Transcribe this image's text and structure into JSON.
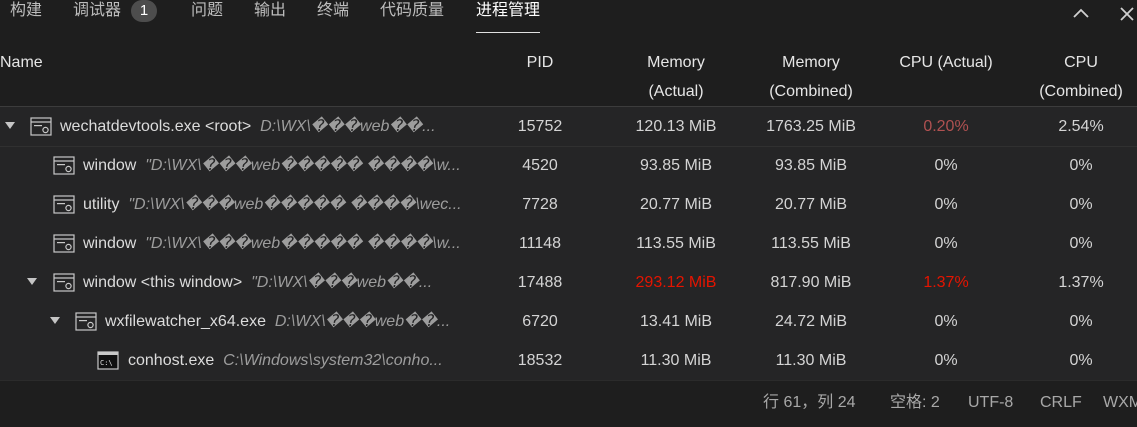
{
  "tabs": [
    {
      "label": "构建"
    },
    {
      "label": "调试器",
      "badge": "1"
    },
    {
      "label": "问题"
    },
    {
      "label": "输出"
    },
    {
      "label": "终端"
    },
    {
      "label": "代码质量"
    },
    {
      "label": "进程管理",
      "active": true
    }
  ],
  "panel_controls": {
    "collapse_icon": "chevron-up-icon",
    "close_icon": "close-icon"
  },
  "columns": {
    "name": "Name",
    "pid": "PID",
    "mem_actual": "Memory\n(Actual)",
    "mem_combined": "Memory\n(Combined)",
    "cpu_actual": "CPU (Actual)",
    "cpu_combined": "CPU\n(Combined)"
  },
  "processes": [
    {
      "name": "wechatdevtools.exe <root>",
      "path": "D:\\WX\\���web��...",
      "pid": "15752",
      "mem_actual": "120.13 MiB",
      "mem_combined": "1763.25 MiB",
      "cpu_actual": "0.20%",
      "cpu_combined": "2.54%",
      "icon": "process-icon"
    },
    {
      "name": "window",
      "path": "\"D:\\WX\\���web����� ����\\w...",
      "pid": "4520",
      "mem_actual": "93.85 MiB",
      "mem_combined": "93.85 MiB",
      "cpu_actual": "0%",
      "cpu_combined": "0%",
      "icon": "process-icon"
    },
    {
      "name": "utility",
      "path": "\"D:\\WX\\���web����� ����\\wec...",
      "pid": "7728",
      "mem_actual": "20.77 MiB",
      "mem_combined": "20.77 MiB",
      "cpu_actual": "0%",
      "cpu_combined": "0%",
      "icon": "process-icon"
    },
    {
      "name": "window",
      "path": "\"D:\\WX\\���web����� ����\\w...",
      "pid": "11148",
      "mem_actual": "113.55 MiB",
      "mem_combined": "113.55 MiB",
      "cpu_actual": "0%",
      "cpu_combined": "0%",
      "icon": "process-icon"
    },
    {
      "name": "window <this window>",
      "path": "\"D:\\WX\\���web��...",
      "pid": "17488",
      "mem_actual": "293.12 MiB",
      "mem_combined": "817.90 MiB",
      "cpu_actual": "1.37%",
      "cpu_combined": "1.37%",
      "icon": "process-icon"
    },
    {
      "name": "wxfilewatcher_x64.exe",
      "path": "D:\\WX\\���web��...",
      "pid": "6720",
      "mem_actual": "13.41 MiB",
      "mem_combined": "24.72 MiB",
      "cpu_actual": "0%",
      "cpu_combined": "0%",
      "icon": "process-icon"
    },
    {
      "name": "conhost.exe",
      "path": "C:\\Windows\\system32\\conho...",
      "pid": "18532",
      "mem_actual": "11.30 MiB",
      "mem_combined": "11.30 MiB",
      "cpu_actual": "0%",
      "cpu_combined": "0%",
      "icon": "console-icon"
    }
  ],
  "status_bar": {
    "position": "行 61，列 24",
    "indent": "空格: 2",
    "encoding": "UTF-8",
    "eol": "CRLF",
    "language": "WXML"
  },
  "colors": {
    "warning_red": "#e51400",
    "muted_red": "#b05151",
    "background": "#1e1e1e"
  }
}
